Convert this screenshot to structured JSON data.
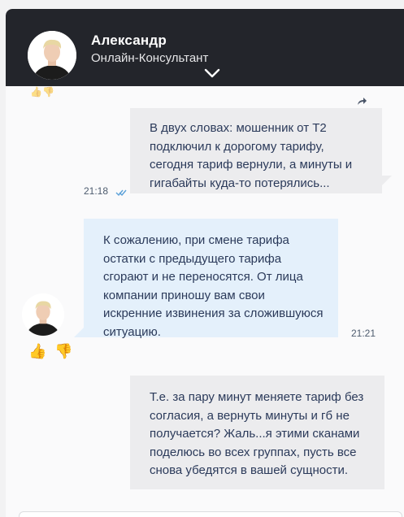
{
  "header": {
    "agent_name": "Александр",
    "agent_role": "Онлайн-Консультант"
  },
  "messages": [
    {
      "sender": "user",
      "text": "В двух словах: мошенник от Т2 подключил к дорогому тарифу, сегодня тариф вернули, а минуты и гигабайты куда-то потерялись...",
      "time": "21:18",
      "status": "read"
    },
    {
      "sender": "agent",
      "text": "К сожалению, при смене тарифа остатки с предыдущего тарифа сгорают и не переносятся. От лица компании приношу вам свои искренние извинения за сложившуюся ситуацию.",
      "time": "21:21"
    },
    {
      "sender": "user",
      "text": "Т.е. за пару минут меняете тариф без согласия, а вернуть минуты и гб не получается? Жаль...я этими сканами поделюсь во всех группах, пусть все снова убедятся в вашей сущности."
    }
  ],
  "icons": {
    "collapse": "chevron-down-icon",
    "share": "share-icon",
    "read_status": "double-check-icon",
    "thumbs_up": "thumbs-up-icon",
    "thumbs_down": "thumbs-down-icon"
  },
  "colors": {
    "header_bg": "#23252b",
    "user_bubble": "#ececee",
    "agent_bubble": "#e4f0fb",
    "message_text": "#2b3a5a",
    "check": "#5aa0d8"
  }
}
